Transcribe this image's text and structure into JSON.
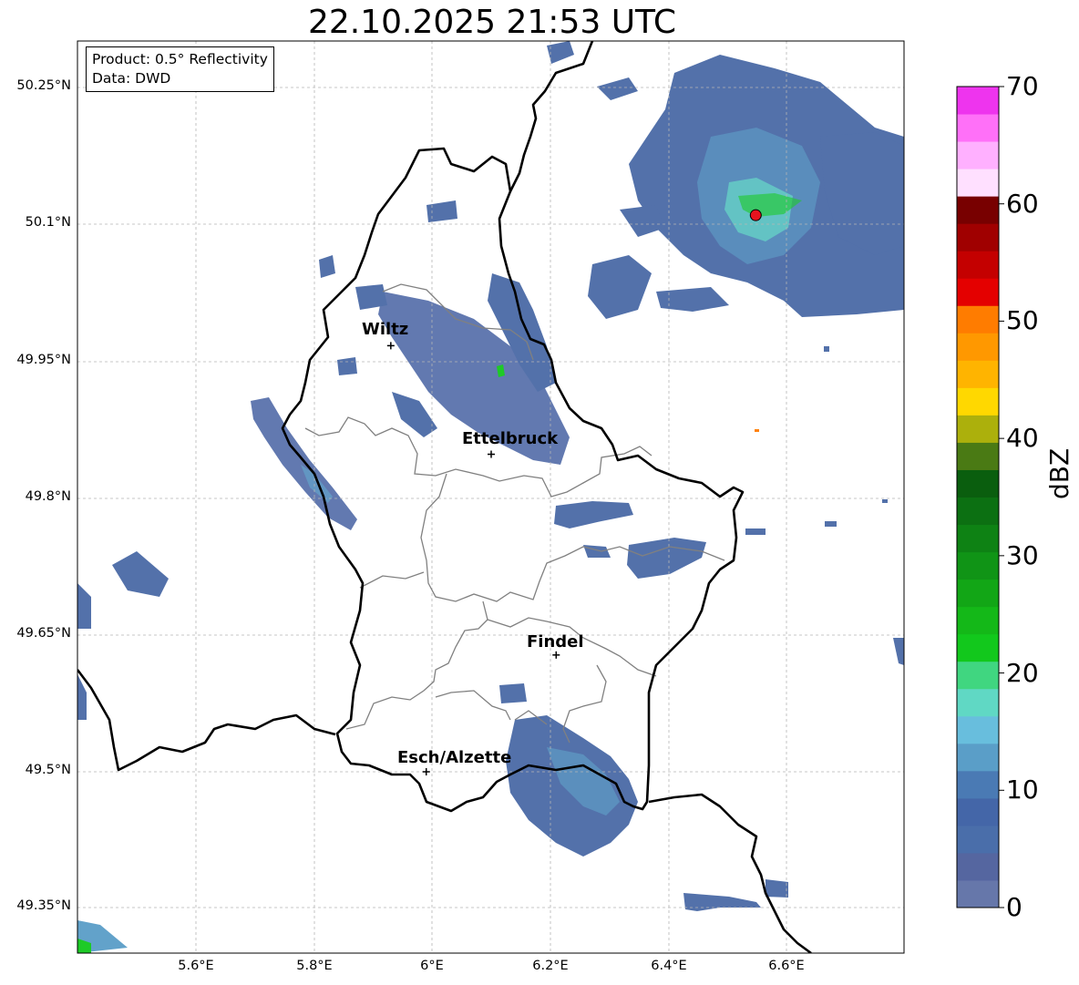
{
  "title": "22.10.2025 21:53 UTC",
  "info": {
    "product": "Product: 0.5° Reflectivity",
    "source": "Data: DWD"
  },
  "latitude_labels": [
    "50.25°N",
    "50.1°N",
    "49.95°N",
    "49.8°N",
    "49.65°N",
    "49.5°N",
    "49.35°N"
  ],
  "longitude_labels": [
    "5.6°E",
    "5.8°E",
    "6°E",
    "6.2°E",
    "6.4°E",
    "6.6°E"
  ],
  "cities": [
    {
      "name": "Wiltz",
      "lon": 5.93,
      "lat": 49.967
    },
    {
      "name": "Ettelbruck",
      "lon": 6.1,
      "lat": 49.848
    },
    {
      "name": "Findel",
      "lon": 6.21,
      "lat": 49.628
    },
    {
      "name": "Esch/Alzette",
      "lon": 5.99,
      "lat": 49.5
    }
  ],
  "radar_site": {
    "lon": 6.548,
    "lat": 50.11,
    "color": "#e8131e"
  },
  "colorbar": {
    "label": "dBZ",
    "ticks": [
      "0",
      "10",
      "20",
      "30",
      "40",
      "50",
      "60",
      "70"
    ],
    "min": 0,
    "max": 70,
    "step": 2.5,
    "colors": [
      "#6677aa",
      "#5566a0",
      "#4a6eaa",
      "#4466a8",
      "#4a7ab4",
      "#5a9ec8",
      "#68bedd",
      "#60d8c4",
      "#40d680",
      "#12c81c",
      "#14b818",
      "#12a616",
      "#109416",
      "#0e8214",
      "#0c7012",
      "#0a5e0e",
      "#4a7a14",
      "#acb00c",
      "#ffd800",
      "#ffb400",
      "#ff9800",
      "#ff7c00",
      "#e40000",
      "#c40000",
      "#a00000",
      "#780000",
      "#ffe0ff",
      "#ffb0ff",
      "#ff70f8",
      "#ee34ee"
    ]
  },
  "legend_items": [
    "Wiltz",
    "Ettelbruck",
    "Findel",
    "Esch/Alzette"
  ]
}
